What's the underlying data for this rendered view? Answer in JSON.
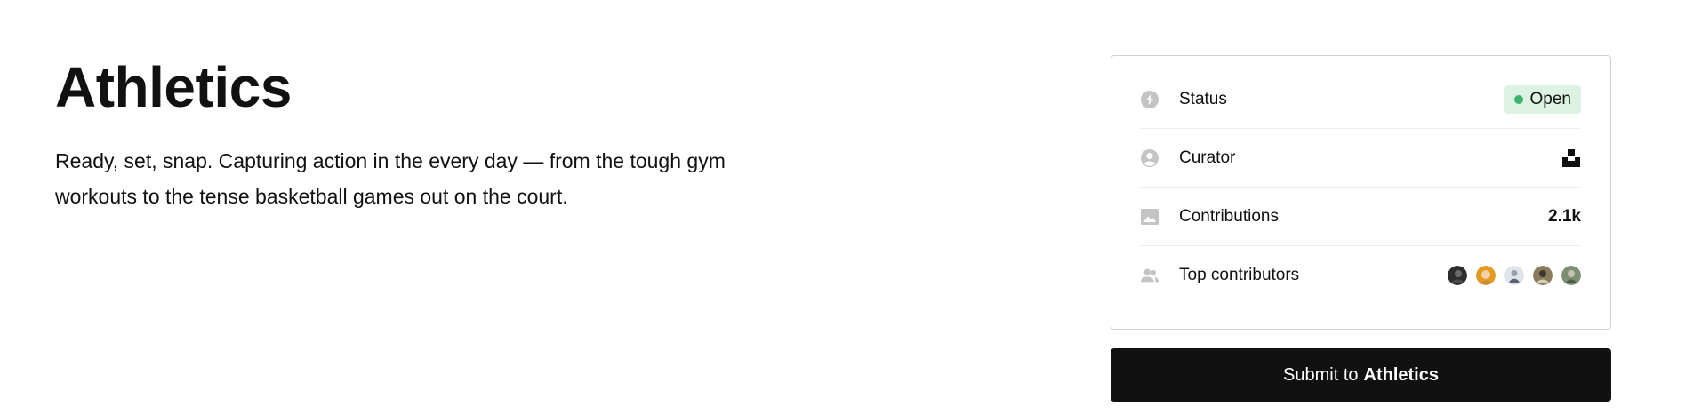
{
  "topic": {
    "title": "Athletics",
    "description": "Ready, set, snap. Capturing action in the every day — from the tough gym workouts to the tense basketball games out on the court."
  },
  "details": {
    "status": {
      "label": "Status",
      "value": "Open",
      "icon": "lightning-icon",
      "badge_color": "#dcf3e3",
      "dot_color": "#3cb46e"
    },
    "curator": {
      "label": "Curator",
      "icon": "user-circle-icon",
      "logo": "unsplash-logo"
    },
    "contributions": {
      "label": "Contributions",
      "value": "2.1k",
      "icon": "image-icon"
    },
    "top_contributors": {
      "label": "Top contributors",
      "icon": "users-icon",
      "avatars": [
        "avatar-1",
        "avatar-2",
        "avatar-3",
        "avatar-4",
        "avatar-5"
      ]
    }
  },
  "submit": {
    "prefix": "Submit to",
    "topic": "Athletics"
  },
  "colors": {
    "button_bg": "#111111",
    "icon_gray": "#c4c4c4",
    "card_border": "#d1d1d1"
  }
}
